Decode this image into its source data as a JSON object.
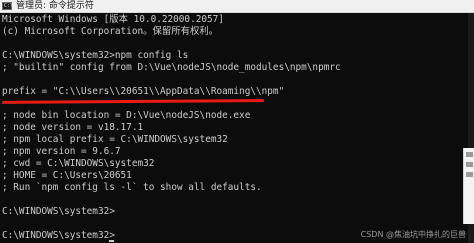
{
  "window": {
    "title": "管理员: 命令提示符",
    "icon": "console-icon",
    "icon_glyph": "C:\\"
  },
  "console": {
    "lines": [
      "Microsoft Windows [版本 10.0.22000.2057]",
      "(c) Microsoft Corporation。保留所有权利。",
      "",
      "C:\\WINDOWS\\system32>npm config ls",
      "; \"builtin\" config from D:\\Vue\\nodeJS\\node_modules\\npm\\npmrc",
      "",
      "prefix = \"C:\\\\Users\\\\20651\\\\AppData\\\\Roaming\\\\npm\"",
      "",
      "; node bin location = D:\\Vue\\nodeJS\\node.exe",
      "; node version = v18.17.1",
      "; npm local prefix = C:\\WINDOWS\\system32",
      "; npm version = 9.6.7",
      "; cwd = C:\\WINDOWS\\system32",
      "; HOME = C:\\Users\\20651",
      "; Run `npm config ls -l` to show all defaults.",
      "",
      "C:\\WINDOWS\\system32>",
      "",
      "C:\\WINDOWS\\system32>"
    ]
  },
  "annotation": {
    "color": "#e81b14"
  },
  "watermark": {
    "text": "CSDN @焦油坑中挣扎的巨兽"
  }
}
